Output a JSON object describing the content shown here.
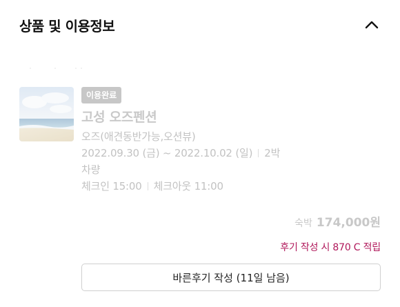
{
  "section": {
    "title": "상품 및 이용정보",
    "collapse_icon": "chevron-up-icon"
  },
  "product": {
    "status_badge": "이용완료",
    "name": "고성 오즈펜션",
    "room": "오즈(애견동반가능,오션뷰)",
    "check_in_date": "2022.09.30 (금)",
    "date_separator": " ~ ",
    "check_out_date": "2022.10.02 (일)",
    "nights": "2박",
    "transport": "차량",
    "check_in_time": "체크인 15:00",
    "check_out_time": "체크아웃 11:00",
    "thumbnail_icon": "beach-photo"
  },
  "price": {
    "label": "숙박",
    "value": "174,000원"
  },
  "review": {
    "reward_text": "후기 작성 시 870 C 적립",
    "button_label": "바른후기 작성 (11일 남음)"
  },
  "colors": {
    "accent": "#b0175a",
    "badge_bg": "#c7c7c7",
    "muted_text": "#c2c2c2"
  }
}
